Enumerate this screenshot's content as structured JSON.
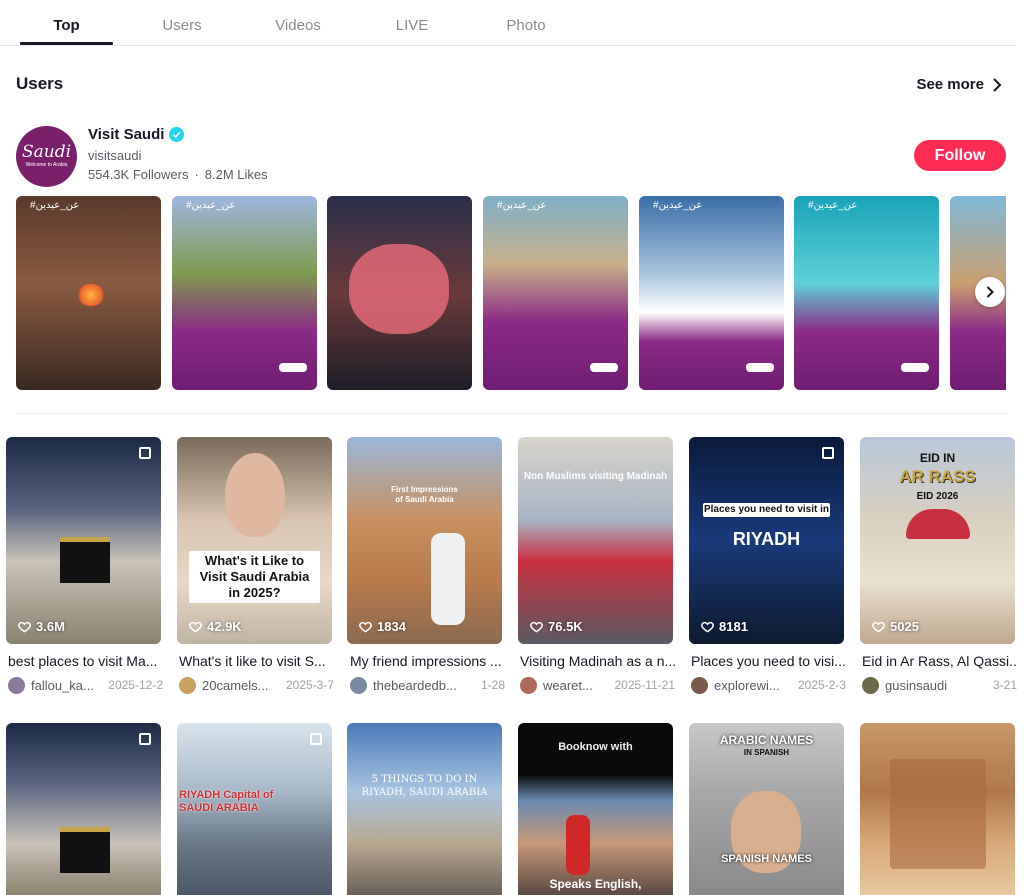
{
  "tabs": [
    {
      "label": "Top"
    },
    {
      "label": "Users"
    },
    {
      "label": "Videos"
    },
    {
      "label": "LIVE"
    },
    {
      "label": "Photo"
    }
  ],
  "users_section": {
    "title": "Users",
    "see_more": "See more"
  },
  "user": {
    "name": "Visit Saudi",
    "handle": "visitsaudi",
    "followers": "554.3K Followers",
    "separator": "·",
    "likes": "8.2M Likes",
    "follow_label": "Follow",
    "logo_text": "Saudi",
    "logo_sub": "Welcome to Arabia"
  },
  "carousel": [
    {
      "tagline": "#عن_عيدين",
      "kind": "photo"
    },
    {
      "tagline": "#عن_عيدين",
      "kind": "purple"
    },
    {
      "tagline": "",
      "kind": "map"
    },
    {
      "tagline": "#عن_عيدين",
      "kind": "purple"
    },
    {
      "tagline": "#عن_عيدين",
      "kind": "purple"
    },
    {
      "tagline": "#عن_عيدين",
      "kind": "purple"
    },
    {
      "tagline": "",
      "kind": "purple"
    }
  ],
  "videos": [
    {
      "views": "3.6M",
      "desc": "best places to visit Ma...",
      "user": "fallou_ka...",
      "date": "2025-12-2",
      "overlay": ""
    },
    {
      "views": "42.9K",
      "desc": "What's it like to visit S...",
      "user": "20camels...",
      "date": "2025-3-7",
      "overlay": "What's it Like to Visit Saudi Arabia in 2025?"
    },
    {
      "views": "1834",
      "desc": "My friend impressions ...",
      "user": "thebeardedb...",
      "date": "1-28",
      "overlay": "First Impressions of Saudi Arabia"
    },
    {
      "views": "76.5K",
      "desc": "Visiting Madinah as a n...",
      "user": "wearet...",
      "date": "2025-11-21",
      "overlay": "Non Muslims visiting Madinah"
    },
    {
      "views": "8181",
      "desc": "Places you need to visi...",
      "user": "explorewi...",
      "date": "2025-2-3",
      "overlay": "Places you need to visit in",
      "overlay2": "RIYADH"
    },
    {
      "views": "5025",
      "desc": "Eid in Ar Rass, Al Qassi...",
      "user": "gusinsaudi",
      "date": "3-21",
      "overlay": "EID IN",
      "overlay2": "AR RASS",
      "overlay3": "EID 2026"
    }
  ],
  "videos_row2": [
    {
      "overlay": ""
    },
    {
      "overlay": "RIYADH Capital of SAUDI ARABIA"
    },
    {
      "overlay": "5 THINGS TO DO IN RIYADH, SAUDI ARABIA"
    },
    {
      "overlay": "Booknow with",
      "overlay2": "Speaks English,"
    },
    {
      "overlay": "ARABIC NAMES",
      "overlay2": "IN SPANISH",
      "overlay3": "SPANISH NAMES"
    },
    {
      "overlay": ""
    }
  ],
  "colors": {
    "accent": "#fe2c55",
    "brand_purple": "#7a1f6a",
    "verified": "#20d5ec"
  }
}
